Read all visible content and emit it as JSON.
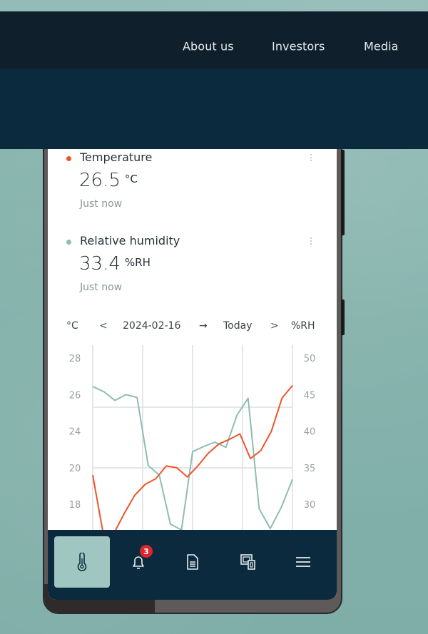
{
  "site_nav": {
    "links": [
      {
        "label": "About us"
      },
      {
        "label": "Investors"
      },
      {
        "label": "Media"
      }
    ]
  },
  "app": {
    "metrics": [
      {
        "name": "Temperature",
        "value": "26.5",
        "unit": "°C",
        "updated": "Just now",
        "color": "#f0532a"
      },
      {
        "name": "Relative humidity",
        "value": "33.4",
        "unit": "%RH",
        "updated": "Just now",
        "color": "#8fbcb4"
      }
    ],
    "chart_header": {
      "left_unit": "°C",
      "prev_icon": "chevron-left-icon",
      "prev_glyph": "<",
      "start_date": "2024-02-16",
      "arrow": "→",
      "end_date": "Today",
      "next_icon": "chevron-right-icon",
      "next_glyph": ">",
      "right_unit": "%RH"
    },
    "bottom_nav": [
      {
        "icon": "thermometer-icon",
        "active": true
      },
      {
        "icon": "bell-icon",
        "badge": "3"
      },
      {
        "icon": "document-icon"
      },
      {
        "icon": "devices-icon"
      },
      {
        "icon": "menu-icon"
      }
    ]
  },
  "chart_data": {
    "type": "line",
    "title": "",
    "xlabel": "",
    "ylabel": "°C",
    "y2label": "%RH",
    "left_ticks": [
      "28",
      "26",
      "24",
      "20",
      "18"
    ],
    "right_ticks": [
      "50",
      "45",
      "40",
      "35",
      "30"
    ],
    "ylim_right": [
      30,
      50
    ],
    "grid": true,
    "series": [
      {
        "name": "Relative humidity",
        "axis": "right",
        "color": "#8fbcb4",
        "values": [
          46.1,
          45.4,
          44.2,
          45.0,
          44.6,
          35.3,
          34.0,
          27.3,
          26.5,
          37.2,
          37.9,
          38.5,
          37.8,
          42.2,
          44.5,
          29.4,
          26.7,
          29.6,
          33.4
        ]
      },
      {
        "name": "Temperature",
        "axis": "left",
        "color": "#f0532a",
        "values": [
          19.6,
          16.4,
          16.4,
          17.5,
          18.5,
          19.1,
          19.4,
          20.2,
          20.0,
          19.5,
          20.2,
          21.6,
          22.6,
          23.1,
          23.7,
          21.0,
          21.9,
          24.0,
          25.8,
          26.5
        ]
      }
    ]
  }
}
